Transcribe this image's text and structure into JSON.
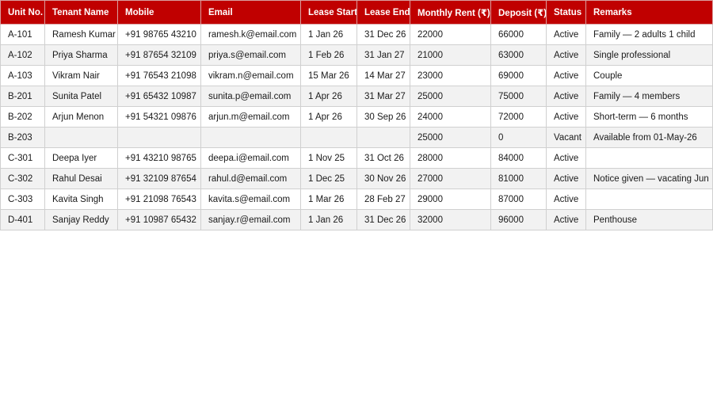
{
  "table": {
    "headers": [
      "Unit No.",
      "Tenant Name",
      "Mobile",
      "Email",
      "Lease Start",
      "Lease End",
      "Monthly Rent (₹)",
      "Deposit (₹)",
      "Status",
      "Remarks"
    ],
    "rows": [
      [
        "A-101",
        "Ramesh Kumar",
        "+91 98765 43210",
        "ramesh.k@email.com",
        "1 Jan 26",
        "31 Dec 26",
        "22000",
        "66000",
        "Active",
        "Family — 2 adults 1 child"
      ],
      [
        "A-102",
        "Priya Sharma",
        "+91 87654 32109",
        "priya.s@email.com",
        "1 Feb 26",
        "31 Jan 27",
        "21000",
        "63000",
        "Active",
        "Single professional"
      ],
      [
        "A-103",
        "Vikram Nair",
        "+91 76543 21098",
        "vikram.n@email.com",
        "15 Mar 26",
        "14 Mar 27",
        "23000",
        "69000",
        "Active",
        "Couple"
      ],
      [
        "B-201",
        "Sunita Patel",
        "+91 65432 10987",
        "sunita.p@email.com",
        "1 Apr 26",
        "31 Mar 27",
        "25000",
        "75000",
        "Active",
        "Family — 4 members"
      ],
      [
        "B-202",
        "Arjun Menon",
        "+91 54321 09876",
        "arjun.m@email.com",
        "1 Apr 26",
        "30 Sep 26",
        "24000",
        "72000",
        "Active",
        "Short-term — 6 months"
      ],
      [
        "B-203",
        "",
        "",
        "",
        "",
        "",
        "25000",
        "0",
        "Vacant",
        "Available from 01-May-26"
      ],
      [
        "C-301",
        "Deepa Iyer",
        "+91 43210 98765",
        "deepa.i@email.com",
        "1 Nov 25",
        "31 Oct 26",
        "28000",
        "84000",
        "Active",
        ""
      ],
      [
        "C-302",
        "Rahul Desai",
        "+91 32109 87654",
        "rahul.d@email.com",
        "1 Dec 25",
        "30 Nov 26",
        "27000",
        "81000",
        "Active",
        "Notice given — vacating Jun"
      ],
      [
        "C-303",
        "Kavita Singh",
        "+91 21098 76543",
        "kavita.s@email.com",
        "1 Mar 26",
        "28 Feb 27",
        "29000",
        "87000",
        "Active",
        ""
      ],
      [
        "D-401",
        "Sanjay Reddy",
        "+91 10987 65432",
        "sanjay.r@email.com",
        "1 Jan 26",
        "31 Dec 26",
        "32000",
        "96000",
        "Active",
        "Penthouse"
      ]
    ]
  },
  "colors": {
    "header_bg": "#c00000",
    "header_text": "#ffffff",
    "stripe": "#f2f2f2",
    "grid": "#d0d0d0"
  }
}
